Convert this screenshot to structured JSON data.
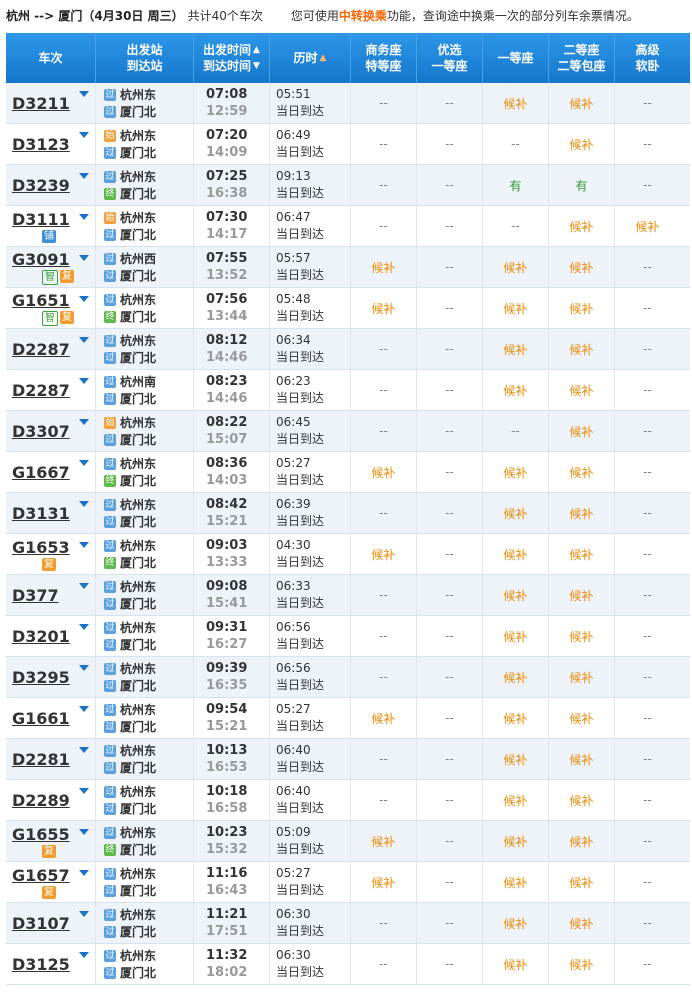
{
  "header": {
    "route": "杭州 --> 厦门（4月30日  周三）",
    "count": "共计40个车次",
    "tip_prefix": "您可使用",
    "tip_link": "中转换乘",
    "tip_suffix": "功能，查询途中换乘一次的部分列车余票情况。"
  },
  "columns": {
    "train": "车次",
    "station_line1": "出发站",
    "station_line2": "到达站",
    "time_line1": "出发时间",
    "time_line2": "到达时间",
    "duration": "历时",
    "business_l1": "商务座",
    "business_l2": "特等座",
    "premium_l1": "优选",
    "premium_l2": "一等座",
    "first": "一等座",
    "second_l1": "二等座",
    "second_l2": "二等包座",
    "soft_l1": "高级",
    "soft_l2": "软卧"
  },
  "icons": {
    "guo": "过",
    "shi": "始",
    "zhong": "终"
  },
  "arrive_text": "当日到达",
  "colors": {
    "header_bg": "#1a7fd4",
    "hb": "#f08a00",
    "you": "#2e9c2e"
  },
  "rows": [
    {
      "no": "D3211",
      "tags": [],
      "from_ic": "过",
      "from": "杭州东",
      "to_ic": "过",
      "to": "厦门北",
      "dep": "07:08",
      "arr": "12:59",
      "dur": "05:51",
      "seats": [
        "--",
        "--",
        "候补",
        "候补",
        "--"
      ]
    },
    {
      "no": "D3123",
      "tags": [],
      "from_ic": "始",
      "from": "杭州东",
      "to_ic": "过",
      "to": "厦门北",
      "dep": "07:20",
      "arr": "14:09",
      "dur": "06:49",
      "seats": [
        "--",
        "--",
        "--",
        "候补",
        "--"
      ]
    },
    {
      "no": "D3239",
      "tags": [],
      "from_ic": "过",
      "from": "杭州东",
      "to_ic": "终",
      "to": "厦门北",
      "dep": "07:25",
      "arr": "16:38",
      "dur": "09:13",
      "seats": [
        "--",
        "--",
        "有",
        "有",
        "--"
      ]
    },
    {
      "no": "D3111",
      "tags": [
        "铺"
      ],
      "from_ic": "始",
      "from": "杭州东",
      "to_ic": "过",
      "to": "厦门北",
      "dep": "07:30",
      "arr": "14:17",
      "dur": "06:47",
      "seats": [
        "--",
        "--",
        "--",
        "候补",
        "候补"
      ]
    },
    {
      "no": "G3091",
      "tags": [
        "智",
        "复"
      ],
      "from_ic": "过",
      "from": "杭州西",
      "to_ic": "过",
      "to": "厦门北",
      "dep": "07:55",
      "arr": "13:52",
      "dur": "05:57",
      "seats": [
        "候补",
        "--",
        "候补",
        "候补",
        "--"
      ]
    },
    {
      "no": "G1651",
      "tags": [
        "智",
        "复"
      ],
      "from_ic": "过",
      "from": "杭州东",
      "to_ic": "终",
      "to": "厦门北",
      "dep": "07:56",
      "arr": "13:44",
      "dur": "05:48",
      "seats": [
        "候补",
        "--",
        "候补",
        "候补",
        "--"
      ]
    },
    {
      "no": "D2287",
      "tags": [],
      "from_ic": "过",
      "from": "杭州东",
      "to_ic": "过",
      "to": "厦门北",
      "dep": "08:12",
      "arr": "14:46",
      "dur": "06:34",
      "seats": [
        "--",
        "--",
        "候补",
        "候补",
        "--"
      ]
    },
    {
      "no": "D2287",
      "tags": [],
      "from_ic": "过",
      "from": "杭州南",
      "to_ic": "过",
      "to": "厦门北",
      "dep": "08:23",
      "arr": "14:46",
      "dur": "06:23",
      "seats": [
        "--",
        "--",
        "候补",
        "候补",
        "--"
      ]
    },
    {
      "no": "D3307",
      "tags": [],
      "from_ic": "始",
      "from": "杭州东",
      "to_ic": "过",
      "to": "厦门北",
      "dep": "08:22",
      "arr": "15:07",
      "dur": "06:45",
      "seats": [
        "--",
        "--",
        "--",
        "候补",
        "--"
      ]
    },
    {
      "no": "G1667",
      "tags": [],
      "from_ic": "过",
      "from": "杭州东",
      "to_ic": "终",
      "to": "厦门北",
      "dep": "08:36",
      "arr": "14:03",
      "dur": "05:27",
      "seats": [
        "候补",
        "--",
        "候补",
        "候补",
        "--"
      ]
    },
    {
      "no": "D3131",
      "tags": [],
      "from_ic": "过",
      "from": "杭州东",
      "to_ic": "过",
      "to": "厦门北",
      "dep": "08:42",
      "arr": "15:21",
      "dur": "06:39",
      "seats": [
        "--",
        "--",
        "候补",
        "候补",
        "--"
      ]
    },
    {
      "no": "G1653",
      "tags": [
        "复"
      ],
      "from_ic": "过",
      "from": "杭州东",
      "to_ic": "终",
      "to": "厦门北",
      "dep": "09:03",
      "arr": "13:33",
      "dur": "04:30",
      "seats": [
        "候补",
        "--",
        "候补",
        "候补",
        "--"
      ]
    },
    {
      "no": "D377",
      "tags": [],
      "from_ic": "过",
      "from": "杭州东",
      "to_ic": "过",
      "to": "厦门北",
      "dep": "09:08",
      "arr": "15:41",
      "dur": "06:33",
      "seats": [
        "--",
        "--",
        "候补",
        "候补",
        "--"
      ]
    },
    {
      "no": "D3201",
      "tags": [],
      "from_ic": "过",
      "from": "杭州东",
      "to_ic": "过",
      "to": "厦门北",
      "dep": "09:31",
      "arr": "16:27",
      "dur": "06:56",
      "seats": [
        "--",
        "--",
        "候补",
        "候补",
        "--"
      ]
    },
    {
      "no": "D3295",
      "tags": [],
      "from_ic": "过",
      "from": "杭州东",
      "to_ic": "过",
      "to": "厦门北",
      "dep": "09:39",
      "arr": "16:35",
      "dur": "06:56",
      "seats": [
        "--",
        "--",
        "候补",
        "候补",
        "--"
      ]
    },
    {
      "no": "G1661",
      "tags": [],
      "from_ic": "过",
      "from": "杭州东",
      "to_ic": "过",
      "to": "厦门北",
      "dep": "09:54",
      "arr": "15:21",
      "dur": "05:27",
      "seats": [
        "候补",
        "--",
        "候补",
        "候补",
        "--"
      ]
    },
    {
      "no": "D2281",
      "tags": [],
      "from_ic": "过",
      "from": "杭州东",
      "to_ic": "过",
      "to": "厦门北",
      "dep": "10:13",
      "arr": "16:53",
      "dur": "06:40",
      "seats": [
        "--",
        "--",
        "候补",
        "候补",
        "--"
      ]
    },
    {
      "no": "D2289",
      "tags": [],
      "from_ic": "过",
      "from": "杭州东",
      "to_ic": "过",
      "to": "厦门北",
      "dep": "10:18",
      "arr": "16:58",
      "dur": "06:40",
      "seats": [
        "--",
        "--",
        "候补",
        "候补",
        "--"
      ]
    },
    {
      "no": "G1655",
      "tags": [
        "复"
      ],
      "from_ic": "过",
      "from": "杭州东",
      "to_ic": "终",
      "to": "厦门北",
      "dep": "10:23",
      "arr": "15:32",
      "dur": "05:09",
      "seats": [
        "候补",
        "--",
        "候补",
        "候补",
        "--"
      ]
    },
    {
      "no": "G1657",
      "tags": [
        "复"
      ],
      "from_ic": "过",
      "from": "杭州东",
      "to_ic": "过",
      "to": "厦门北",
      "dep": "11:16",
      "arr": "16:43",
      "dur": "05:27",
      "seats": [
        "候补",
        "--",
        "候补",
        "候补",
        "--"
      ]
    },
    {
      "no": "D3107",
      "tags": [],
      "from_ic": "过",
      "from": "杭州东",
      "to_ic": "过",
      "to": "厦门北",
      "dep": "11:21",
      "arr": "17:51",
      "dur": "06:30",
      "seats": [
        "--",
        "--",
        "候补",
        "候补",
        "--"
      ]
    },
    {
      "no": "D3125",
      "tags": [],
      "from_ic": "过",
      "from": "杭州东",
      "to_ic": "过",
      "to": "厦门北",
      "dep": "11:32",
      "arr": "18:02",
      "dur": "06:30",
      "seats": [
        "--",
        "--",
        "候补",
        "候补",
        "--"
      ]
    }
  ]
}
